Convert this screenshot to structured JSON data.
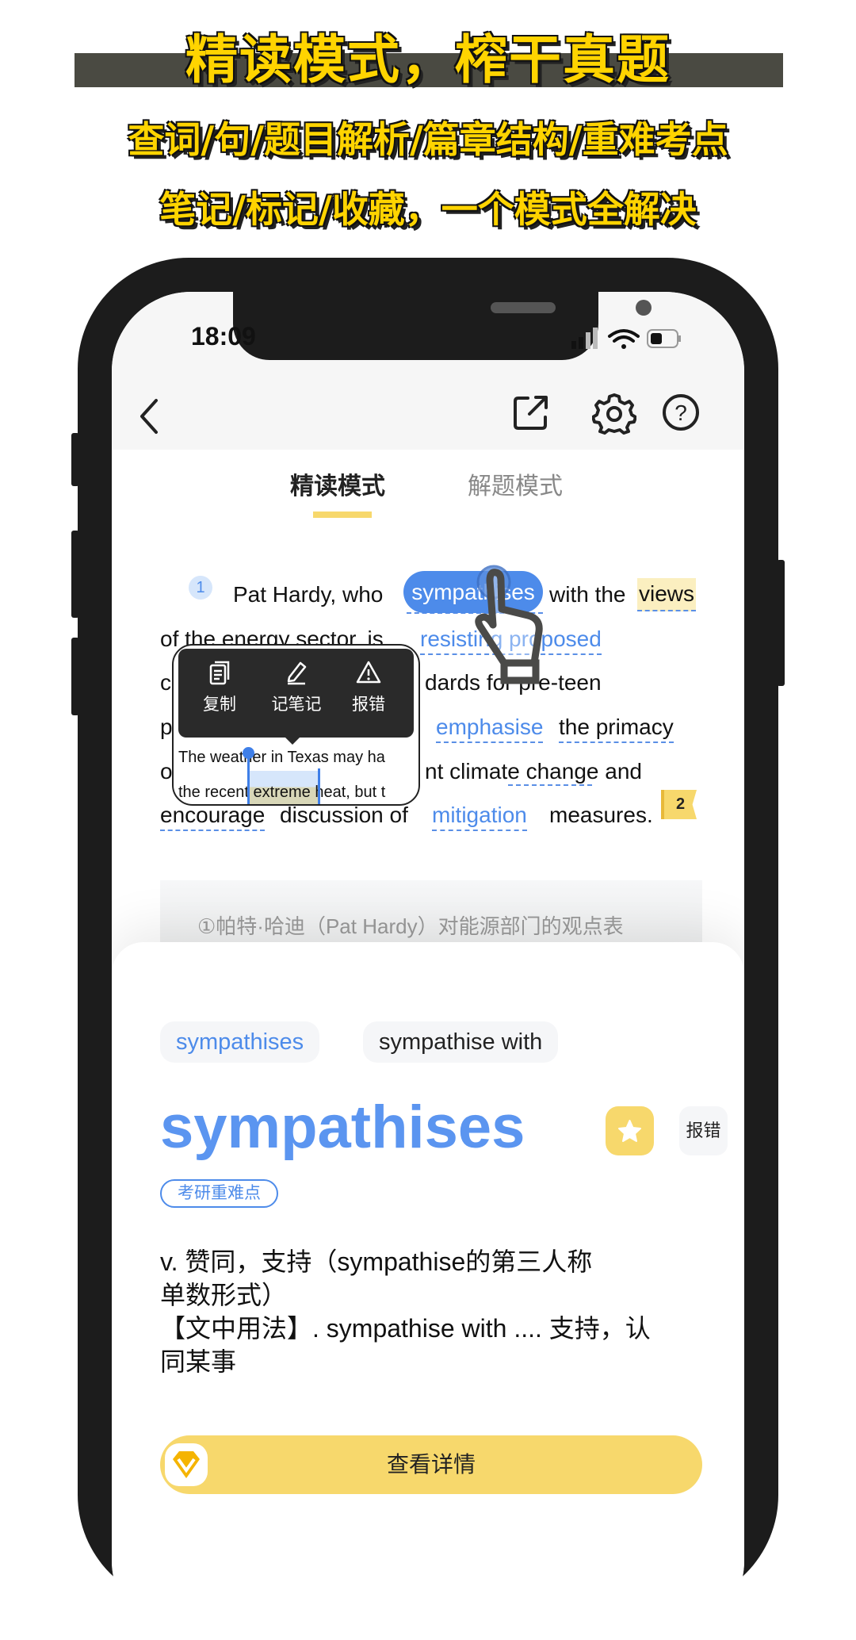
{
  "promo": {
    "title": "精读模式，榨干真题",
    "line2": "查词/句/题目解析/篇章结构/重难考点",
    "line3": "笔记/标记/收藏，一个模式全解决"
  },
  "status": {
    "time": "18:09"
  },
  "nav": {
    "icons": [
      "chevron-left-icon",
      "share-icon",
      "gear-icon",
      "help-icon"
    ]
  },
  "tabs": [
    {
      "label": "精读模式",
      "active": true
    },
    {
      "label": "解题模式",
      "active": false
    }
  ],
  "paragraph": {
    "number": "1",
    "l1": {
      "a": "Pat Hardy, who",
      "word": "sympathises",
      "b": "with the",
      "c": "views"
    },
    "l2": {
      "a": "of the energy sector, is",
      "b": "resisting proposed"
    },
    "l3": {
      "a": "c",
      "b": "dards for pre-teen"
    },
    "l4": {
      "a": "p",
      "b": "emphasise",
      "c": "the primacy"
    },
    "l5": {
      "a": "o",
      "b": "nt climate change and"
    },
    "l6": {
      "a": "encourage",
      "b": "discussion of",
      "c": "mitigation",
      "d": "measures."
    },
    "next_number": "2"
  },
  "popup": {
    "copy": "复制",
    "note": "记笔记",
    "report": "报错",
    "text1": "The weather in Texas may ha",
    "text2a": "the recent",
    "text2sel": "extreme",
    "text2b": "heat, but t"
  },
  "translation": "①帕特·哈迪（Pat Hardy）对能源部门的观点表",
  "sheet": {
    "chips": [
      "sympathises",
      "sympathise with"
    ],
    "word": "sympathises",
    "report": "报错",
    "tag": "考研重难点",
    "def": [
      "v. 赞同，支持（sympathise的第三人称",
      "单数形式）",
      "【文中用法】. sympathise with .... 支持，认",
      "同某事"
    ],
    "cta": "查看详情"
  },
  "colors": {
    "accent": "#4d8bea",
    "yellow": "#f7d86c",
    "promo": "#ffd400"
  }
}
